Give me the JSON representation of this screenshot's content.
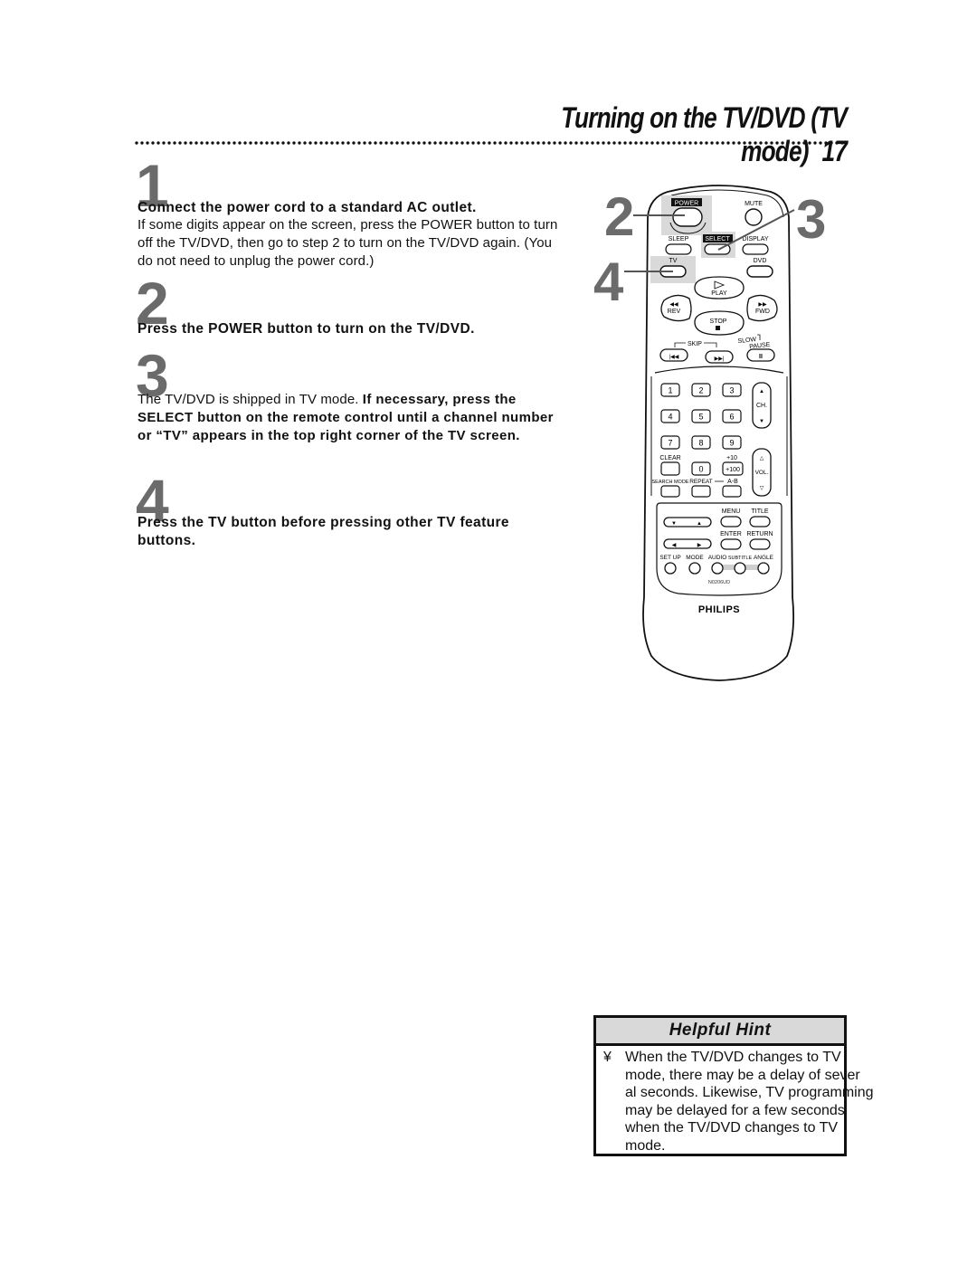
{
  "header": {
    "title": "Turning on the TV/DVD (TV mode)",
    "page_number": "17"
  },
  "steps": [
    {
      "number": "1",
      "heading": "Connect the power cord to a standard AC outlet.",
      "body": "If some digits appear on the screen, press the POWER button to turn off the TV/DVD, then go to step 2 to turn on the TV/DVD again. (You do not need to unplug the power cord.)"
    },
    {
      "number": "2",
      "heading": "Press the POWER button to turn on the TV/DVD."
    },
    {
      "number": "3",
      "body_plain": "The TV/DVD is shipped in TV mode. ",
      "body_bold": "If necessary, press the SELECT button on the remote control until a channel number or “TV” appears in the top right corner of the TV screen."
    },
    {
      "number": "4",
      "heading": "Press the TV button before pressing other TV feature buttons."
    }
  ],
  "remote": {
    "callouts": [
      "2",
      "3",
      "4"
    ],
    "brand": "PHILIPS",
    "model": "N0206UD",
    "buttons": {
      "power": "POWER",
      "mute": "MUTE",
      "sleep": "SLEEP",
      "select": "SELECT",
      "display": "DISPLAY",
      "tv": "TV",
      "dvd": "DVD",
      "play": "PLAY",
      "rev": "REV",
      "fwd": "FWD",
      "stop": "STOP",
      "skip": "SKIP",
      "slow": "SLOW",
      "pause": "PAUSE",
      "digits": [
        "1",
        "2",
        "3",
        "4",
        "5",
        "6",
        "7",
        "8",
        "9",
        "0"
      ],
      "ch": "CH.",
      "vol": "VOL.",
      "clear": "CLEAR",
      "plus10": "+10",
      "plus100": "+100",
      "search_mode": "SEARCH MODE",
      "repeat": "REPEAT",
      "ab": "A-B",
      "menu": "MENU",
      "title": "TITLE",
      "enter": "ENTER",
      "return": "RETURN",
      "setup": "SET UP",
      "mode": "MODE",
      "audio": "AUDIO",
      "subtitle": "SUBTITLE",
      "angle": "ANGLE"
    }
  },
  "hint": {
    "title": "Helpful Hint",
    "bullet": "¥",
    "text": "When the TV/DVD changes to TV\nmode, there may be a delay of sever\nal seconds. Likewise, TV programming\nmay be delayed for a few seconds\nwhen the TV/DVD changes to TV\nmode."
  }
}
